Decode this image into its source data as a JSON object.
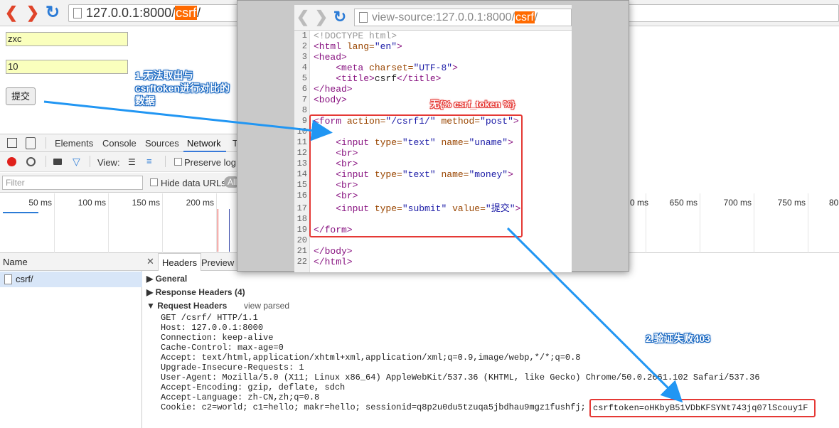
{
  "browser": {
    "url_prefix": "127.0.0.1:8000/",
    "url_highlight": "csrf",
    "url_suffix": "/"
  },
  "form": {
    "uname_value": "zxc",
    "money_value": "10",
    "submit_label": "提交"
  },
  "annotations": {
    "note1": [
      "1.无法取出与",
      "csrftoken进行对比的",
      "数据"
    ],
    "note2": "2.验证失败403",
    "red_label": "无{% csrf_token %}"
  },
  "devtools": {
    "tabs": [
      "Elements",
      "Console",
      "Sources",
      "Network",
      "T"
    ],
    "active_tab": "Network",
    "view_label": "View:",
    "preserve_log": "Preserve log",
    "filter_placeholder": "Filter",
    "hide_data_urls": "Hide data URLs",
    "all_label": "All",
    "ticks": [
      "50 ms",
      "100 ms",
      "150 ms",
      "200 ms",
      "650 ms",
      "700 ms",
      "750 ms",
      "80"
    ],
    "partial_tick": "0 ms",
    "name_header": "Name",
    "request_name": "csrf/",
    "detail_tabs": [
      "Headers",
      "Preview"
    ],
    "sections": {
      "general": "General",
      "response_headers": "Response Headers (4)",
      "request_headers": "Request Headers",
      "view_parsed": "view parsed"
    },
    "request_lines": [
      "GET /csrf/ HTTP/1.1",
      "Host: 127.0.0.1:8000",
      "Connection: keep-alive",
      "Cache-Control: max-age=0",
      "Accept: text/html,application/xhtml+xml,application/xml;q=0.9,image/webp,*/*;q=0.8",
      "Upgrade-Insecure-Requests: 1",
      "User-Agent: Mozilla/5.0 (X11; Linux x86_64) AppleWebKit/537.36 (KHTML, like Gecko) Chrome/50.0.2661.102 Safari/537.36",
      "Accept-Encoding: gzip, deflate, sdch",
      "Accept-Language: zh-CN,zh;q=0.8"
    ],
    "cookie_line": "Cookie: c2=world; c1=hello; makr=hello; sessionid=q8p2u0du5tzuqa5jbdhau9mgz1fushfj;",
    "csrf_token": "csrftoken=oHKbyB51VDbKFSYNt743jq07lScouy1F"
  },
  "popup": {
    "url_prefix": "view-source:127.0.0.1:8000/",
    "url_highlight": "csrf",
    "url_suffix": "/",
    "line_numbers": [
      "1",
      "2",
      "3",
      "4",
      "5",
      "6",
      "7",
      "8",
      "9",
      "10",
      "11",
      "12",
      "13",
      "14",
      "15",
      "16",
      "17",
      "18",
      "19",
      "20",
      "21",
      "22"
    ]
  },
  "colors": {
    "accent_red": "#e53935",
    "arrow_blue": "#2196f3",
    "url_highlight_bg": "#ff6a00"
  }
}
